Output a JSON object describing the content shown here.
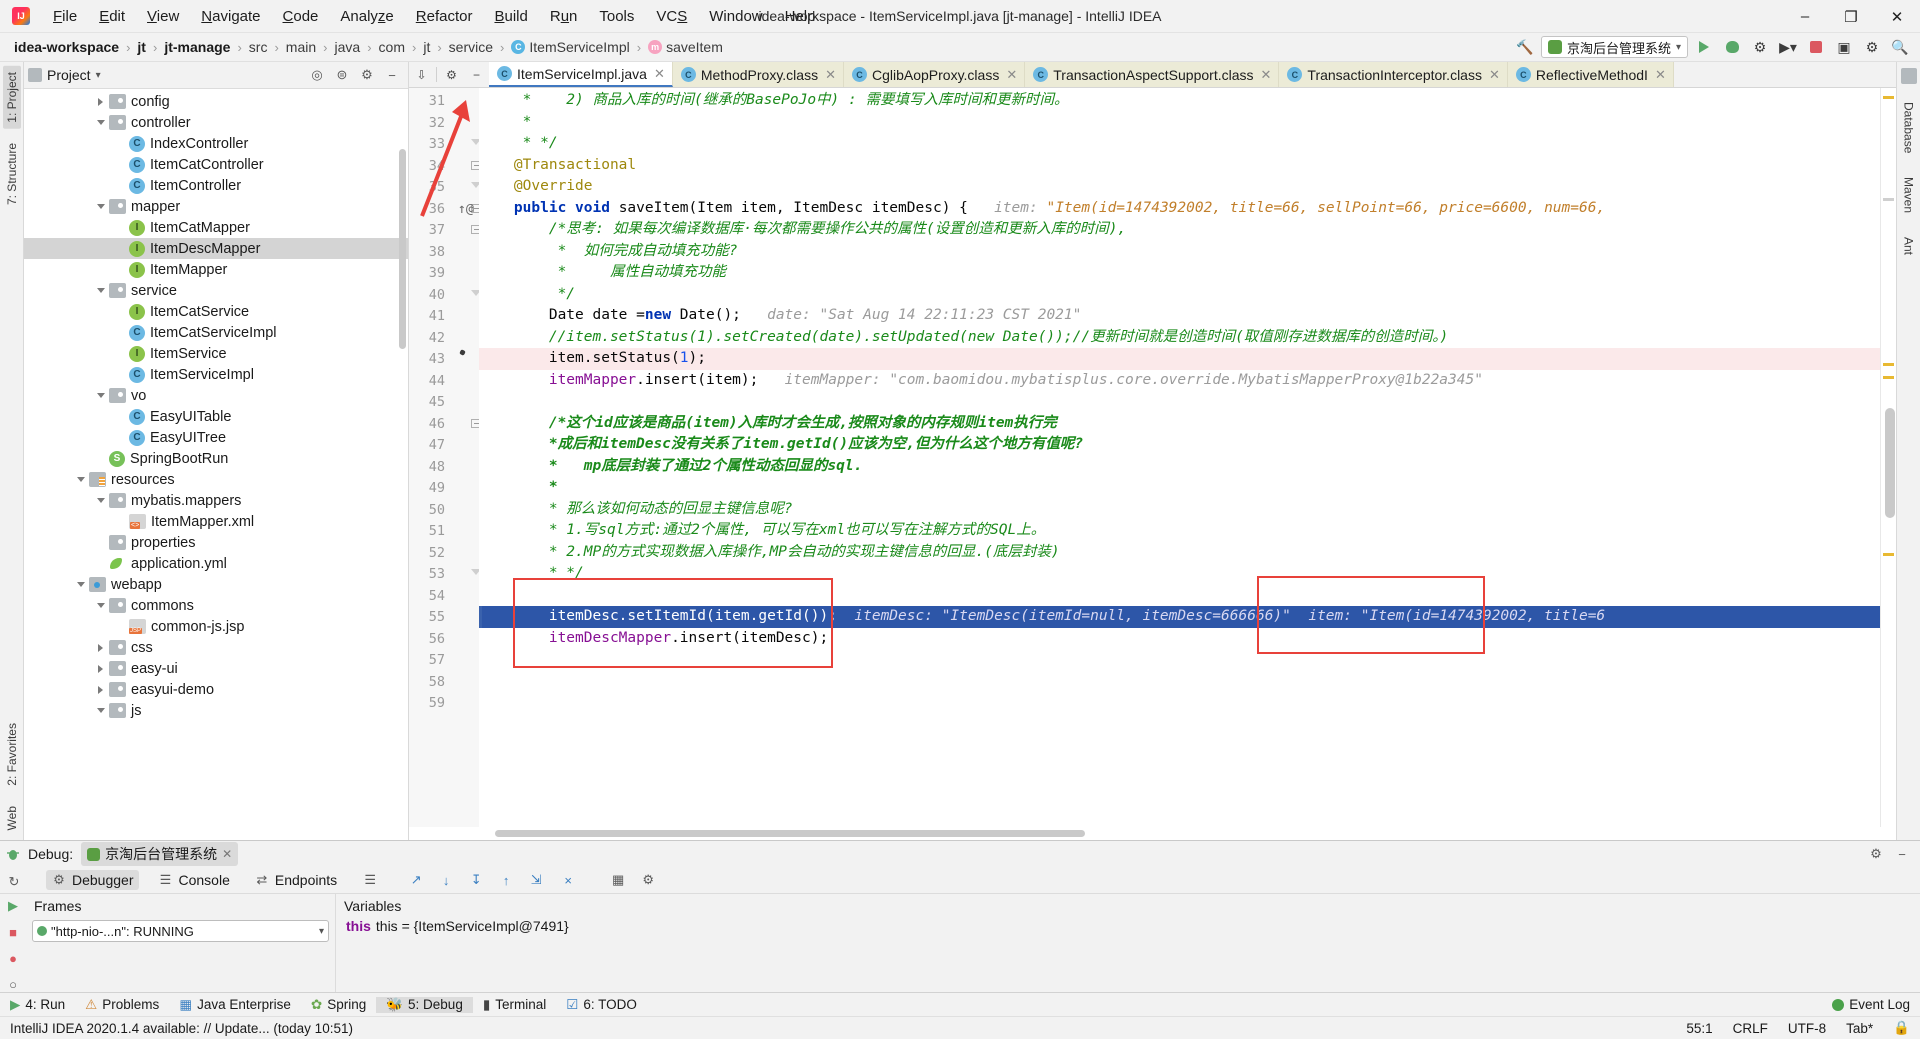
{
  "titlebar": {
    "logo": "intellij-logo",
    "window_title": "idea-workspace - ItemServiceImpl.java [jt-manage] - IntelliJ IDEA",
    "menus": [
      "File",
      "Edit",
      "View",
      "Navigate",
      "Code",
      "Analyze",
      "Refactor",
      "Build",
      "Run",
      "Tools",
      "VCS",
      "Window",
      "Help"
    ],
    "minimize": "–",
    "maximize": "❐",
    "close": "✕"
  },
  "breadcrumb": {
    "items": [
      {
        "label": "idea-workspace",
        "bold": true,
        "icon": ""
      },
      {
        "label": "jt",
        "bold": true,
        "icon": ""
      },
      {
        "label": "jt-manage",
        "bold": true,
        "icon": ""
      },
      {
        "label": "src",
        "bold": false,
        "icon": ""
      },
      {
        "label": "main",
        "bold": false,
        "icon": ""
      },
      {
        "label": "java",
        "bold": false,
        "icon": ""
      },
      {
        "label": "com",
        "bold": false,
        "icon": ""
      },
      {
        "label": "jt",
        "bold": false,
        "icon": ""
      },
      {
        "label": "service",
        "bold": false,
        "icon": ""
      },
      {
        "label": "ItemServiceImpl",
        "bold": false,
        "icon": "class-icon"
      },
      {
        "label": "saveItem",
        "bold": false,
        "icon": "method-icon"
      }
    ],
    "separator": "›",
    "run_config": "京淘后台管理系统",
    "run_config_caret": "▾",
    "toolbar_icons": [
      "hammer-icon",
      "run-icon",
      "debug-icon",
      "debug-attach-icon",
      "coverage-icon",
      "stop-icon",
      "layout-icon",
      "settings-icon",
      "search-icon"
    ]
  },
  "project_panel": {
    "title": "Project",
    "title_caret": "▾",
    "header_icons": [
      "target-icon",
      "collapse-all-icon",
      "gear-icon",
      "hide-icon"
    ],
    "tree": [
      {
        "indent": 3,
        "arrow": "right",
        "icon": "folder",
        "label": "config"
      },
      {
        "indent": 3,
        "arrow": "down",
        "icon": "folder",
        "label": "controller"
      },
      {
        "indent": 4,
        "arrow": "none",
        "icon": "class",
        "label": "IndexController"
      },
      {
        "indent": 4,
        "arrow": "none",
        "icon": "class",
        "label": "ItemCatController"
      },
      {
        "indent": 4,
        "arrow": "none",
        "icon": "class",
        "label": "ItemController"
      },
      {
        "indent": 3,
        "arrow": "down",
        "icon": "folder",
        "label": "mapper"
      },
      {
        "indent": 4,
        "arrow": "none",
        "icon": "interface",
        "label": "ItemCatMapper"
      },
      {
        "indent": 4,
        "arrow": "none",
        "icon": "interface",
        "label": "ItemDescMapper",
        "selected": true
      },
      {
        "indent": 4,
        "arrow": "none",
        "icon": "interface",
        "label": "ItemMapper"
      },
      {
        "indent": 3,
        "arrow": "down",
        "icon": "folder",
        "label": "service"
      },
      {
        "indent": 4,
        "arrow": "none",
        "icon": "interface",
        "label": "ItemCatService"
      },
      {
        "indent": 4,
        "arrow": "none",
        "icon": "class",
        "label": "ItemCatServiceImpl"
      },
      {
        "indent": 4,
        "arrow": "none",
        "icon": "interface",
        "label": "ItemService"
      },
      {
        "indent": 4,
        "arrow": "none",
        "icon": "class",
        "label": "ItemServiceImpl"
      },
      {
        "indent": 3,
        "arrow": "down",
        "icon": "folder",
        "label": "vo"
      },
      {
        "indent": 4,
        "arrow": "none",
        "icon": "class",
        "label": "EasyUITable"
      },
      {
        "indent": 4,
        "arrow": "none",
        "icon": "class",
        "label": "EasyUITree"
      },
      {
        "indent": 3,
        "arrow": "none",
        "icon": "spring",
        "label": "SpringBootRun"
      },
      {
        "indent": 2,
        "arrow": "down",
        "icon": "folder-src",
        "label": "resources"
      },
      {
        "indent": 3,
        "arrow": "down",
        "icon": "folder",
        "label": "mybatis.mappers"
      },
      {
        "indent": 4,
        "arrow": "none",
        "icon": "xml",
        "label": "ItemMapper.xml"
      },
      {
        "indent": 3,
        "arrow": "none",
        "icon": "folder",
        "label": "properties"
      },
      {
        "indent": 3,
        "arrow": "none",
        "icon": "yml",
        "label": "application.yml"
      },
      {
        "indent": 2,
        "arrow": "down",
        "icon": "folder-web",
        "label": "webapp"
      },
      {
        "indent": 3,
        "arrow": "down",
        "icon": "folder",
        "label": "commons"
      },
      {
        "indent": 4,
        "arrow": "none",
        "icon": "jsp",
        "label": "common-js.jsp"
      },
      {
        "indent": 3,
        "arrow": "right",
        "icon": "folder",
        "label": "css"
      },
      {
        "indent": 3,
        "arrow": "right",
        "icon": "folder",
        "label": "easy-ui"
      },
      {
        "indent": 3,
        "arrow": "right",
        "icon": "folder",
        "label": "easyui-demo"
      },
      {
        "indent": 3,
        "arrow": "down",
        "icon": "folder",
        "label": "js"
      }
    ]
  },
  "left_rail": {
    "top": [
      "1: Project",
      "7: Structure"
    ],
    "bottom": [
      "2: Favorites",
      "Web"
    ]
  },
  "right_rail": {
    "items": [
      "Database",
      "Maven",
      "Ant"
    ]
  },
  "editor": {
    "tabs": [
      {
        "label": "ItemServiceImpl.java",
        "active": true,
        "icon": "class-icon",
        "close": "✕"
      },
      {
        "label": "MethodProxy.class",
        "active": false,
        "icon": "class-icon",
        "close": "✕"
      },
      {
        "label": "CglibAopProxy.class",
        "active": false,
        "icon": "class-icon",
        "close": "✕"
      },
      {
        "label": "TransactionAspectSupport.class",
        "active": false,
        "icon": "class-icon",
        "close": "✕"
      },
      {
        "label": "TransactionInterceptor.class",
        "active": false,
        "icon": "class-icon",
        "close": "✕"
      },
      {
        "label": "ReflectiveMethodI",
        "active": false,
        "icon": "class-icon",
        "close": "✕"
      }
    ],
    "lines": [
      {
        "n": 31,
        "partial": true,
        "segs": [
          {
            "t": "     *    2) 商品入库的时间(继承的BasePoJo中) : 需要填写入库时间和更新时间。",
            "c": "cmt"
          }
        ]
      },
      {
        "n": 32,
        "segs": [
          {
            "t": "     *",
            "c": "cmt"
          }
        ]
      },
      {
        "n": 33,
        "fold": "dog",
        "segs": [
          {
            "t": "     * */",
            "c": "cmt"
          }
        ]
      },
      {
        "n": 34,
        "fold": "minus",
        "segs": [
          {
            "t": "    @Transactional",
            "c": "anno"
          }
        ]
      },
      {
        "n": 35,
        "fold": "dog",
        "segs": [
          {
            "t": "    @Override",
            "c": "anno"
          }
        ]
      },
      {
        "n": 36,
        "fold": "minus",
        "mark": "override-run",
        "segs": [
          {
            "t": "    ",
            "c": "plain"
          },
          {
            "t": "public void ",
            "c": "kw"
          },
          {
            "t": "saveItem(Item item, ItemDesc itemDesc) {",
            "c": "plain"
          },
          {
            "t": "   item: ",
            "c": "hint"
          },
          {
            "t": "\"Item(id=1474392002, title=66, sellPoint=66, price=6600, num=66,",
            "c": "hint-v"
          }
        ]
      },
      {
        "n": 37,
        "fold": "minus",
        "segs": [
          {
            "t": "        /*思考: 如果每次编译数据库·每次都需要操作公共的属性(设置创造和更新入库的时间),",
            "c": "cmt"
          }
        ]
      },
      {
        "n": 38,
        "segs": [
          {
            "t": "         *  如何完成自动填充功能?",
            "c": "cmt"
          }
        ]
      },
      {
        "n": 39,
        "segs": [
          {
            "t": "         *     属性自动填充功能",
            "c": "cmt"
          }
        ]
      },
      {
        "n": 40,
        "fold": "dog",
        "segs": [
          {
            "t": "         */",
            "c": "cmt"
          }
        ]
      },
      {
        "n": 41,
        "segs": [
          {
            "t": "        Date date =",
            "c": "plain"
          },
          {
            "t": "new ",
            "c": "kw"
          },
          {
            "t": "Date();",
            "c": "plain"
          },
          {
            "t": "   date: ",
            "c": "hint"
          },
          {
            "t": "\"Sat Aug 14 22:11:23 CST 2021\"",
            "c": "hint"
          }
        ]
      },
      {
        "n": 42,
        "segs": [
          {
            "t": "        //item.setStatus(1).setCreated(date).setUpdated(new Date());//更新时间就是创造时间(取值刚存进数据库的创造时间。)",
            "c": "cmt"
          }
        ]
      },
      {
        "n": 43,
        "bp": true,
        "segs": [
          {
            "t": "        item.setStatus(",
            "c": "plain"
          },
          {
            "t": "1",
            "c": "num"
          },
          {
            "t": ");",
            "c": "plain"
          }
        ]
      },
      {
        "n": 44,
        "segs": [
          {
            "t": "        ",
            "c": "plain"
          },
          {
            "t": "itemMapper",
            "c": "fld"
          },
          {
            "t": ".insert(item);",
            "c": "plain"
          },
          {
            "t": "   itemMapper: ",
            "c": "hint"
          },
          {
            "t": "\"com.baomidou.mybatisplus.core.override.MybatisMapperProxy@1b22a345\"",
            "c": "hint"
          }
        ]
      },
      {
        "n": 45,
        "segs": [
          {
            "t": "",
            "c": "plain"
          }
        ]
      },
      {
        "n": 46,
        "fold": "minus",
        "segs": [
          {
            "t": "        /*这个id应该是商品(item)入库时才会生成,按照对象的内存规则item执行完",
            "c": "cmt-b"
          }
        ]
      },
      {
        "n": 47,
        "segs": [
          {
            "t": "        *成后和itemDesc没有关系了item.getId()应该为空,但为什么这个地方有值呢?",
            "c": "cmt-b"
          }
        ]
      },
      {
        "n": 48,
        "segs": [
          {
            "t": "        *   mp底层封装了通过2个属性动态回显的sql.",
            "c": "cmt-b"
          }
        ]
      },
      {
        "n": 49,
        "segs": [
          {
            "t": "        *",
            "c": "cmt-b"
          }
        ]
      },
      {
        "n": 50,
        "segs": [
          {
            "t": "        * 那么该如何动态的回显主键信息呢?",
            "c": "cmt"
          }
        ]
      },
      {
        "n": 51,
        "segs": [
          {
            "t": "        * 1.写sql方式:通过2个属性, 可以写在xml也可以写在注解方式的SQL上。",
            "c": "cmt"
          }
        ]
      },
      {
        "n": 52,
        "segs": [
          {
            "t": "        * 2.MP的方式实现数据入库操作,MP会自动的实现主键信息的回显.(底层封装)",
            "c": "cmt"
          }
        ]
      },
      {
        "n": 53,
        "fold": "dog",
        "segs": [
          {
            "t": "        * */",
            "c": "cmt"
          }
        ]
      },
      {
        "n": 54,
        "segs": [
          {
            "t": "",
            "c": "plain"
          }
        ]
      },
      {
        "n": 55,
        "selected": true,
        "segs": [
          {
            "t": "        itemDesc.setItemId(item.getId());",
            "c": "plain"
          },
          {
            "t": "  itemDesc: ",
            "c": "hint"
          },
          {
            "t": "\"ItemDesc(itemId=null, itemDesc=666666)\"",
            "c": "hint"
          },
          {
            "t": "  item: ",
            "c": "hint"
          },
          {
            "t": "\"Item(id=1474392002, title=6",
            "c": "hint"
          }
        ]
      },
      {
        "n": 56,
        "segs": [
          {
            "t": "        ",
            "c": "plain"
          },
          {
            "t": "itemDescMapper",
            "c": "fld"
          },
          {
            "t": ".insert(itemDesc);",
            "c": "plain"
          }
        ]
      },
      {
        "n": 57,
        "segs": [
          {
            "t": "",
            "c": "plain"
          }
        ]
      },
      {
        "n": 58,
        "segs": [
          {
            "t": "",
            "c": "plain"
          }
        ]
      },
      {
        "n": 59,
        "segs": [
          {
            "t": "",
            "c": "plain"
          }
        ]
      }
    ],
    "annotations": {
      "red_box_left": "highlight-code-block",
      "red_box_right": "highlight-inline-value",
      "red_arrow": "pointer-arrow"
    }
  },
  "debug_panel": {
    "label": "Debug:",
    "session_name": "京淘后台管理系统",
    "session_close": "✕",
    "tabs": [
      {
        "label": "Debugger",
        "icon": "debugger-icon",
        "active": true
      },
      {
        "label": "Console",
        "icon": "console-icon",
        "active": false
      },
      {
        "label": "Endpoints",
        "icon": "endpoints-icon",
        "active": false
      }
    ],
    "toolbar_icons": [
      "list-icon",
      "step-over-icon",
      "step-into-icon",
      "force-step-into-icon",
      "step-out-icon",
      "run-to-cursor-icon",
      "evaluate-icon",
      "mute-breakpoints-icon",
      "settings-icon"
    ],
    "frames_header": "Frames",
    "variables_header": "Variables",
    "thread": "\"http-nio-...n\": RUNNING",
    "thread_caret": "▾",
    "variable_line": "this = {ItemServiceImpl@7491}",
    "panel_icons": [
      "settings-icon",
      "minimize-icon"
    ]
  },
  "status_bar": {
    "items": [
      {
        "label": "4: Run",
        "icon": "run-icon",
        "active": false
      },
      {
        "label": "Problems",
        "icon": "problems-icon",
        "active": false
      },
      {
        "label": "Java Enterprise",
        "icon": "jee-icon",
        "active": false
      },
      {
        "label": "Spring",
        "icon": "spring-icon",
        "active": false
      },
      {
        "label": "5: Debug",
        "icon": "debug-icon",
        "active": true
      },
      {
        "label": "Terminal",
        "icon": "terminal-icon",
        "active": false
      },
      {
        "label": "6: TODO",
        "icon": "todo-icon",
        "active": false
      }
    ],
    "event_log": "Event Log",
    "event_log_icon": "event-log-icon"
  },
  "bottom_bar": {
    "message": "IntelliJ IDEA 2020.1.4 available: // Update... (today 10:51)",
    "caret_pos": "55:1",
    "line_sep": "CRLF",
    "encoding": "UTF-8",
    "indent": "Tab*",
    "lock_icon": "lock-icon"
  },
  "colors": {
    "accent_blue": "#2d56a8",
    "selection_blue": "#2d56a8",
    "breakpoint_red": "#db5860",
    "annotation_red": "#e8413a",
    "comment_green": "#1a8a1a",
    "keyword_blue": "#0033b3",
    "field_purple": "#871094",
    "annotation_gold": "#9e880d",
    "tab_inactive": "#ecebd7"
  }
}
